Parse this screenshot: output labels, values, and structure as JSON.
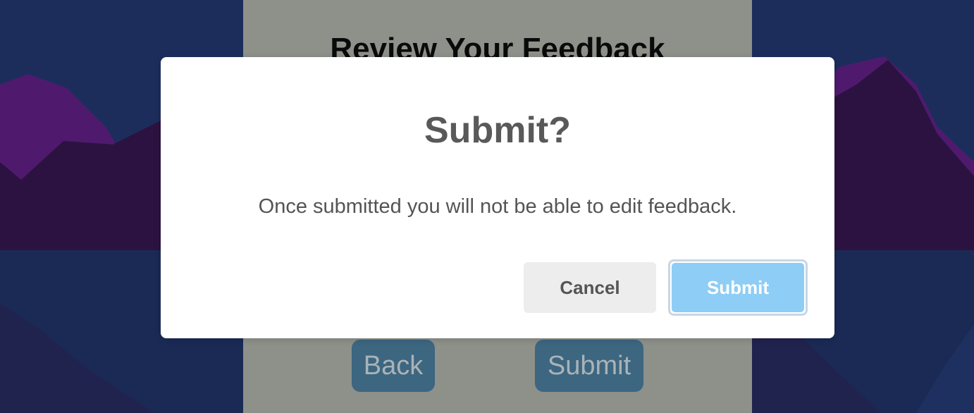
{
  "page": {
    "title": "Review Your Feedback",
    "back_label": "Back",
    "submit_label": "Submit"
  },
  "dialog": {
    "title": "Submit?",
    "message": "Once submitted you will not be able to edit feedback.",
    "cancel_label": "Cancel",
    "confirm_label": "Submit"
  },
  "colors": {
    "background_sky": "#1c2d5c",
    "mountain_purple": "#4f1a6e",
    "mountain_dark": "#2c1240",
    "panel": "#8e908a",
    "panel_button": "#3d6680",
    "confirm_button": "#8ecdf5",
    "cancel_button": "#ededed"
  }
}
